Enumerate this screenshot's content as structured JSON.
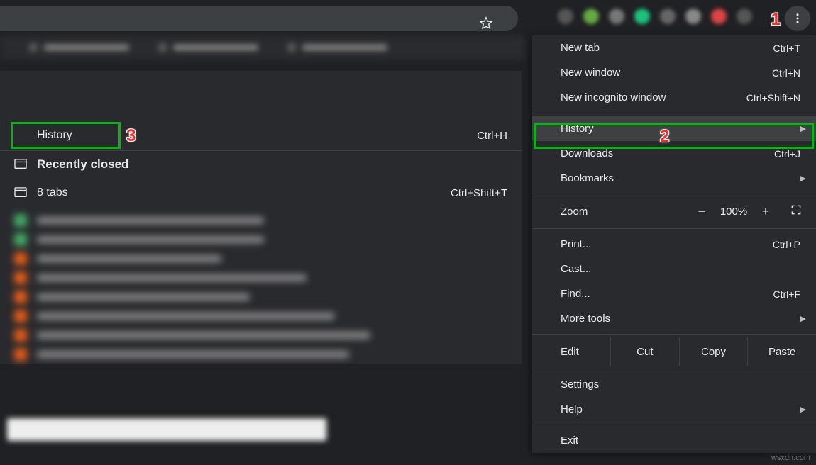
{
  "menu": {
    "new_tab": {
      "label": "New tab",
      "shortcut": "Ctrl+T"
    },
    "new_window": {
      "label": "New window",
      "shortcut": "Ctrl+N"
    },
    "incognito": {
      "label": "New incognito window",
      "shortcut": "Ctrl+Shift+N"
    },
    "history": {
      "label": "History"
    },
    "downloads": {
      "label": "Downloads",
      "shortcut": "Ctrl+J"
    },
    "bookmarks": {
      "label": "Bookmarks"
    },
    "zoom": {
      "label": "Zoom",
      "minus": "−",
      "value": "100%",
      "plus": "+"
    },
    "print": {
      "label": "Print...",
      "shortcut": "Ctrl+P"
    },
    "cast": {
      "label": "Cast..."
    },
    "find": {
      "label": "Find...",
      "shortcut": "Ctrl+F"
    },
    "more_tools": {
      "label": "More tools"
    },
    "edit": {
      "label": "Edit",
      "cut": "Cut",
      "copy": "Copy",
      "paste": "Paste"
    },
    "settings": {
      "label": "Settings"
    },
    "help": {
      "label": "Help"
    },
    "exit": {
      "label": "Exit"
    }
  },
  "submenu": {
    "history": {
      "label": "History",
      "shortcut": "Ctrl+H"
    },
    "recently": {
      "label": "Recently closed"
    },
    "tabs": {
      "label": "8 tabs",
      "shortcut": "Ctrl+Shift+T"
    }
  },
  "annotations": {
    "a1": "1",
    "a2": "2",
    "a3": "3"
  },
  "watermark": "wsxdn.com"
}
